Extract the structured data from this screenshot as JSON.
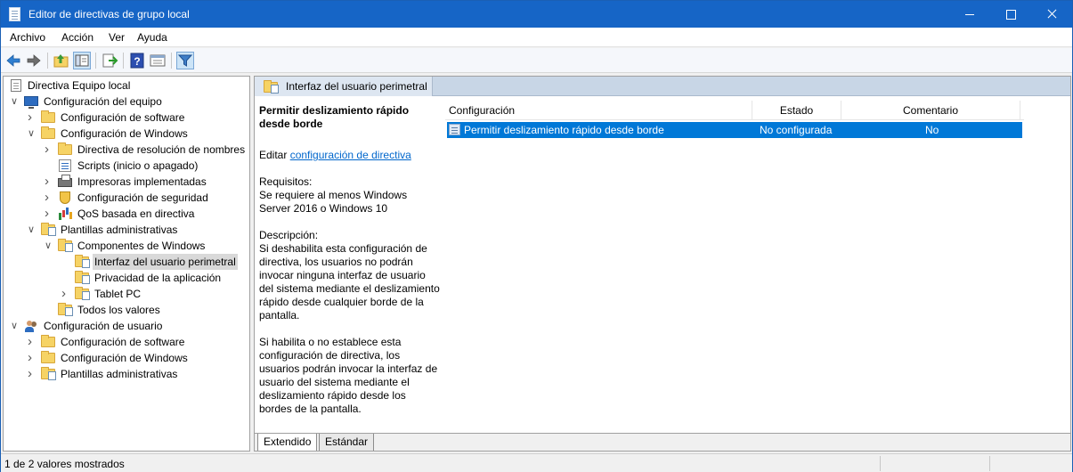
{
  "window": {
    "title": "Editor de directivas de grupo local"
  },
  "menu": [
    "Archivo",
    "Acción",
    "Ver",
    "Ayuda"
  ],
  "toolbar": {
    "buttons": [
      "back-icon",
      "forward-icon",
      "up-folder-icon",
      "show-hide-tree-icon",
      "export-list-icon",
      "help-icon",
      "properties-icon",
      "filter-icon"
    ]
  },
  "tree": [
    {
      "label": "Directiva Equipo local",
      "icon": "doc-icon",
      "expander": ""
    },
    {
      "label": "Configuración del equipo",
      "icon": "computer-icon",
      "expander": "v"
    },
    {
      "label": "Configuración de software",
      "icon": "folder-icon",
      "expander": ">"
    },
    {
      "label": "Configuración de Windows",
      "icon": "folder-icon",
      "expander": "v"
    },
    {
      "label": "Directiva de resolución de nombres",
      "icon": "folder-icon",
      "expander": ">"
    },
    {
      "label": "Scripts (inicio o apagado)",
      "icon": "scripts-icon",
      "expander": ""
    },
    {
      "label": "Impresoras implementadas",
      "icon": "printer-icon",
      "expander": ">"
    },
    {
      "label": "Configuración de seguridad",
      "icon": "security-icon",
      "expander": ">"
    },
    {
      "label": "QoS basada en directiva",
      "icon": "chart-icon",
      "expander": ">"
    },
    {
      "label": "Plantillas administrativas",
      "icon": "policy-folder-icon",
      "expander": "v"
    },
    {
      "label": "Componentes de Windows",
      "icon": "policy-folder-icon",
      "expander": "v"
    },
    {
      "label": "Interfaz del usuario perimetral",
      "icon": "policy-folder-icon",
      "expander": ""
    },
    {
      "label": "Privacidad de la aplicación",
      "icon": "policy-folder-icon",
      "expander": ""
    },
    {
      "label": "Tablet PC",
      "icon": "policy-folder-icon",
      "expander": ">"
    },
    {
      "label": "Todos los valores",
      "icon": "policy-folder-icon",
      "expander": ""
    },
    {
      "label": "Configuración de usuario",
      "icon": "users-icon",
      "expander": "v"
    },
    {
      "label": "Configuración de software",
      "icon": "folder-icon",
      "expander": ">"
    },
    {
      "label": "Configuración de Windows",
      "icon": "folder-icon",
      "expander": ">"
    },
    {
      "label": "Plantillas administrativas",
      "icon": "policy-folder-icon",
      "expander": ">"
    }
  ],
  "header": {
    "title": "Interfaz del usuario perimetral"
  },
  "description": {
    "title": "Permitir deslizamiento rápido desde borde",
    "edit_prefix": "Editar",
    "edit_link": "configuración de directiva",
    "requirements_label": "Requisitos:",
    "requirements_text": "Se requiere al menos Windows Server 2016 o Windows 10",
    "description_label": "Descripción:",
    "description_p1": "Si deshabilita esta configuración de directiva, los usuarios no podrán invocar ninguna interfaz de usuario del sistema mediante el deslizamiento rápido desde cualquier borde de la pantalla.",
    "description_p2": "Si habilita o no establece esta configuración de directiva, los usuarios podrán invocar la interfaz de usuario del sistema mediante el deslizamiento rápido desde los bordes de la pantalla."
  },
  "list": {
    "columns": [
      "Configuración",
      "Estado",
      "Comentario"
    ],
    "rows": [
      {
        "setting": "Permitir deslizamiento rápido desde borde",
        "state": "No configurada",
        "comment": "No"
      }
    ]
  },
  "tabs": [
    "Extendido",
    "Estándar"
  ],
  "status": {
    "text": "1 de 2 valores mostrados"
  }
}
